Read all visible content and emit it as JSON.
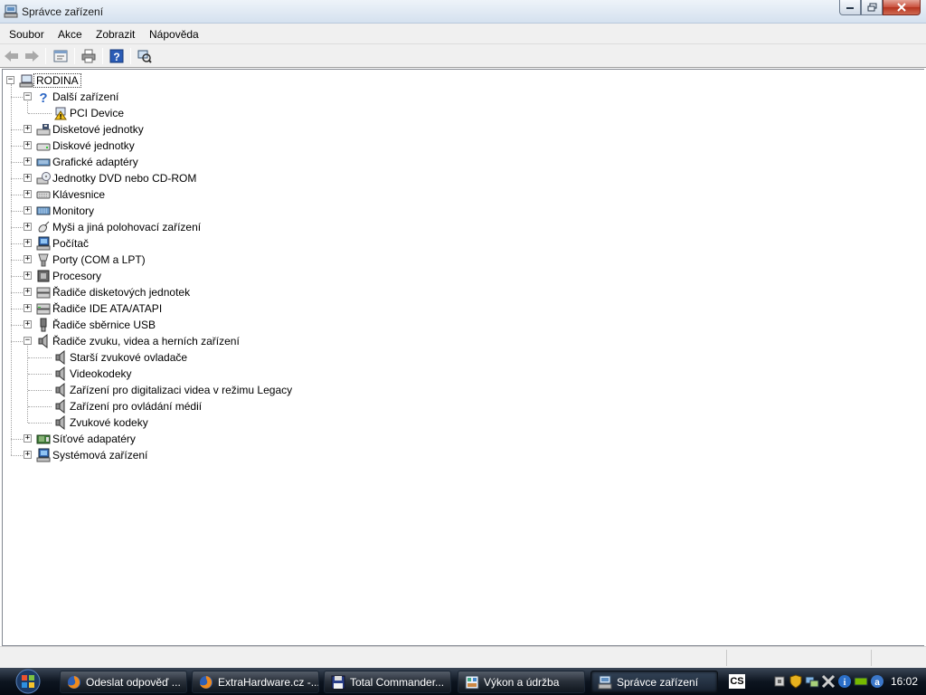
{
  "window": {
    "title": "Správce zařízení"
  },
  "menubar": {
    "items": [
      "Soubor",
      "Akce",
      "Zobrazit",
      "Nápověda"
    ]
  },
  "tree": {
    "root": "RODINA",
    "nodes": [
      {
        "label": "Další zařízení",
        "icon": "question-mark-icon",
        "expanded": true
      },
      {
        "label": "PCI Device",
        "icon": "warning-device-icon",
        "child": true
      },
      {
        "label": "Disketové jednotky",
        "icon": "floppy-drive-icon",
        "expanded": false
      },
      {
        "label": "Diskové jednotky",
        "icon": "hard-disk-icon",
        "expanded": false
      },
      {
        "label": "Grafické adaptéry",
        "icon": "display-adapter-icon",
        "expanded": false
      },
      {
        "label": "Jednotky DVD nebo CD-ROM",
        "icon": "dvd-drive-icon",
        "expanded": false
      },
      {
        "label": "Klávesnice",
        "icon": "keyboard-icon",
        "expanded": false
      },
      {
        "label": "Monitory",
        "icon": "monitor-icon",
        "expanded": false
      },
      {
        "label": "Myši a jiná polohovací zařízení",
        "icon": "mouse-icon",
        "expanded": false
      },
      {
        "label": "Počítač",
        "icon": "computer-icon",
        "expanded": false
      },
      {
        "label": "Porty (COM a LPT)",
        "icon": "port-icon",
        "expanded": false
      },
      {
        "label": "Procesory",
        "icon": "processor-icon",
        "expanded": false
      },
      {
        "label": "Řadiče disketových jednotek",
        "icon": "floppy-controller-icon",
        "expanded": false
      },
      {
        "label": "Řadiče IDE ATA/ATAPI",
        "icon": "ide-controller-icon",
        "expanded": false
      },
      {
        "label": "Řadiče sběrnice USB",
        "icon": "usb-icon",
        "expanded": false
      },
      {
        "label": "Řadiče zvuku, videa a herních zařízení",
        "icon": "speaker-icon",
        "expanded": true
      },
      {
        "label": "Starší zvukové ovladače",
        "icon": "speaker-icon",
        "child": true
      },
      {
        "label": "Videokodeky",
        "icon": "speaker-icon",
        "child": true
      },
      {
        "label": "Zařízení pro digitalizaci videa v režimu Legacy",
        "icon": "speaker-icon",
        "child": true
      },
      {
        "label": "Zařízení pro ovládání médií",
        "icon": "speaker-icon",
        "child": true
      },
      {
        "label": "Zvukové kodeky",
        "icon": "speaker-icon",
        "child": true
      },
      {
        "label": "Síťové adapatéry",
        "icon": "network-adapter-icon",
        "expanded": false
      },
      {
        "label": "Systémová zařízení",
        "icon": "system-device-icon",
        "expanded": false
      }
    ]
  },
  "taskbar": {
    "buttons": [
      {
        "label": "Odeslat odpověď ...",
        "icon": "firefox-icon",
        "active": false
      },
      {
        "label": "ExtraHardware.cz -...",
        "icon": "firefox-icon",
        "active": false
      },
      {
        "label": "Total Commander...",
        "icon": "floppy-save-icon",
        "active": false
      },
      {
        "label": "Výkon a údržba",
        "icon": "control-panel-icon",
        "active": false
      },
      {
        "label": "Správce zařízení",
        "icon": "device-manager-icon",
        "active": true
      }
    ],
    "language": "CS",
    "clock": "16:02"
  }
}
